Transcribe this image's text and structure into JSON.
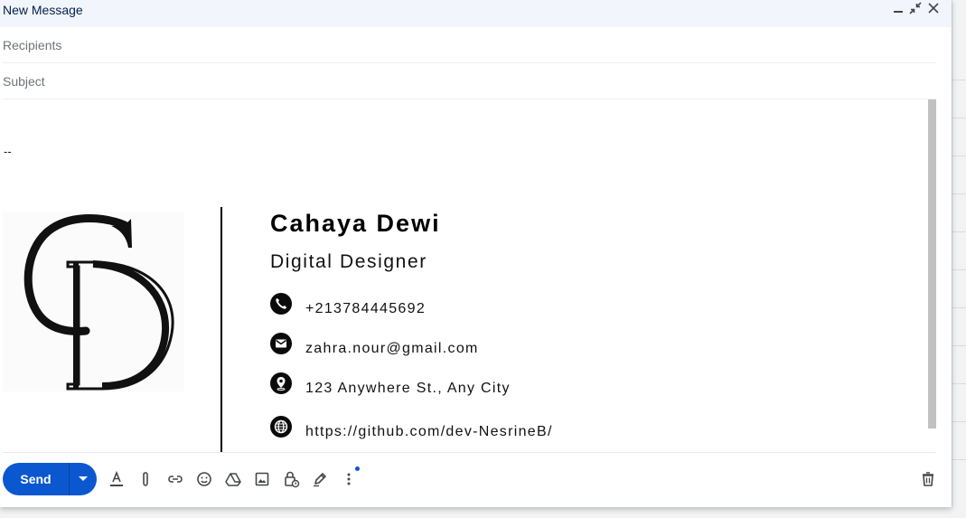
{
  "window": {
    "title": "New Message"
  },
  "fields": {
    "recipients_placeholder": "Recipients",
    "subject_placeholder": "Subject"
  },
  "signature": {
    "dash": "--",
    "logo_letters": "CD",
    "name": "Cahaya Dewi",
    "role": "Digital Designer",
    "phone": "+213784445692",
    "email": "zahra.nour@gmail.com",
    "address": "123 Anywhere St., Any City",
    "website": "https://github.com/dev-NesrineB/"
  },
  "toolbar": {
    "send_label": "Send",
    "icons": [
      "formatting-icon",
      "attach-icon",
      "link-icon",
      "emoji-icon",
      "drive-icon",
      "photo-icon",
      "confidential-icon",
      "signature-icon",
      "more-options-icon",
      "discard-icon"
    ]
  },
  "colors": {
    "accent": "#0b57d0",
    "titlebar": "#f2f6fc"
  }
}
